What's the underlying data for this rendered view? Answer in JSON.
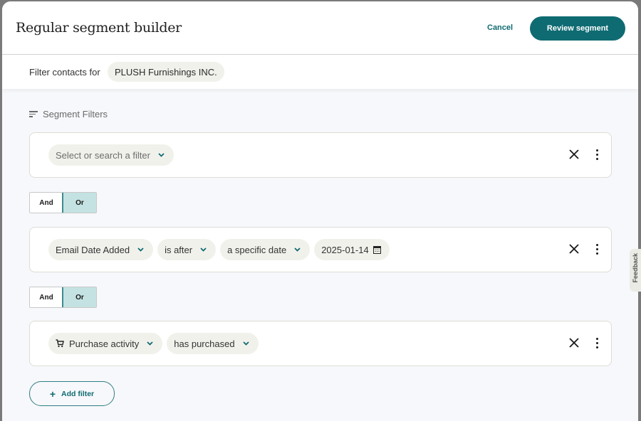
{
  "header": {
    "title": "Regular segment builder",
    "cancel_label": "Cancel",
    "review_label": "Review segment"
  },
  "subheader": {
    "label": "Filter contacts for",
    "account": "PLUSH Furnishings INC."
  },
  "segment_filters": {
    "heading": "Segment Filters",
    "icon": "filter-lines-icon"
  },
  "filters": [
    {
      "chips": [
        {
          "text": "Select or search a filter",
          "placeholder": true
        }
      ]
    },
    {
      "chips": [
        {
          "text": "Email Date Added"
        },
        {
          "text": "is after"
        },
        {
          "text": "a specific date"
        },
        {
          "text": "2025-01-14",
          "icon": "calendar-icon"
        }
      ]
    },
    {
      "chips": [
        {
          "text": "Purchase activity",
          "icon": "cart-icon"
        },
        {
          "text": "has purchased"
        }
      ]
    }
  ],
  "connectors": [
    {
      "and_label": "And",
      "or_label": "Or",
      "selected": "Or"
    },
    {
      "and_label": "And",
      "or_label": "Or",
      "selected": "Or"
    }
  ],
  "add_filter_label": "Add filter",
  "feedback_label": "Feedback",
  "colors": {
    "brand": "#0f6b72",
    "selected_toggle": "#c4e2e2",
    "chip_bg": "#f1f1ec"
  }
}
